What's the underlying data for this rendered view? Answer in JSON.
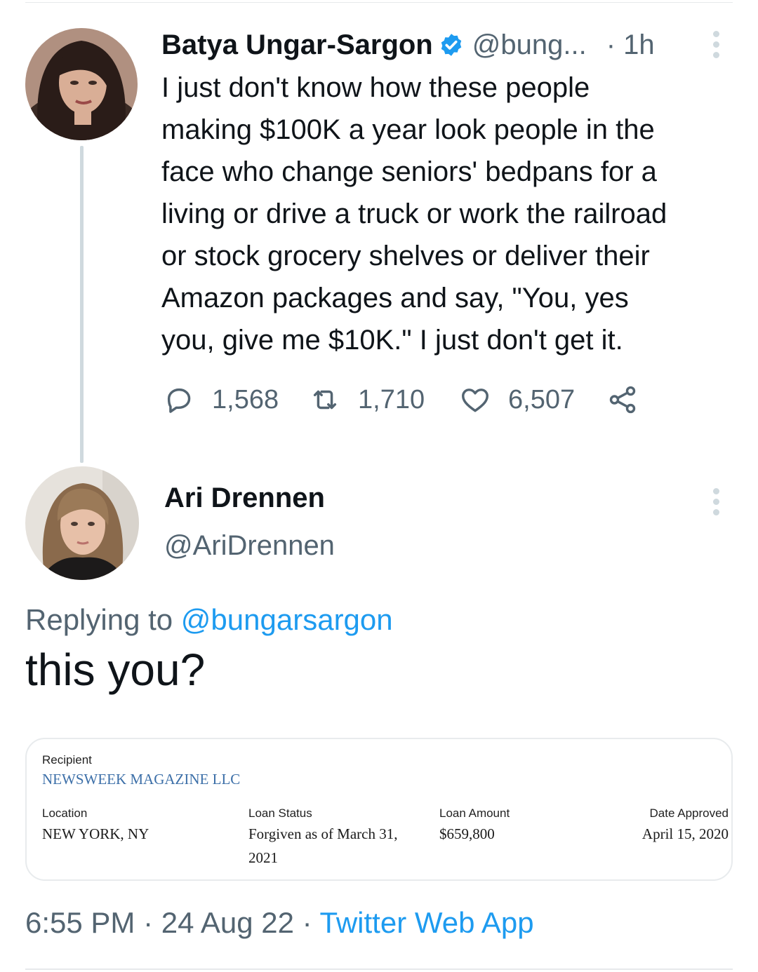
{
  "parent_tweet": {
    "author_name": "Batya Ungar-Sargon",
    "handle": "@bung...",
    "time": "· 1h",
    "text": "I just don't know how these people\nmaking $100K a year look people in the\nface who change seniors' bedpans for a\nliving or drive a truck or work the railroad\nor stock grocery shelves or deliver their\nAmazon packages and say, \"You, yes\nyou, give me $10K.\" I just don't get it.",
    "replies": "1,568",
    "retweets": "1,710",
    "likes": "6,507",
    "icons": {
      "verified": "verified-badge-icon",
      "more": "more-vertical-icon",
      "reply": "reply-bubble-icon",
      "retweet": "retweet-icon",
      "like": "heart-icon",
      "share": "share-icon"
    }
  },
  "reply_tweet": {
    "author_name": "Ari Drennen",
    "handle": "@AriDrennen",
    "replying_prefix": "Replying to ",
    "replying_to": "@bungarsargon",
    "text": "this you?"
  },
  "card": {
    "recipient_label": "Recipient",
    "recipient_value": "NEWSWEEK MAGAZINE LLC",
    "location_label": "Location",
    "location_value": "NEW YORK, NY",
    "loan_status_label": "Loan Status",
    "loan_status_line1": "Forgiven as of March 31,",
    "loan_status_line2": "2021",
    "loan_amount_label": "Loan Amount",
    "loan_amount_value": "$659,800",
    "date_approved_label": "Date Approved",
    "date_approved_value": "April 15, 2020"
  },
  "footer": {
    "time": "6:55 PM",
    "sep1": " · ",
    "date": "24 Aug 22",
    "sep2": " · ",
    "app": "Twitter Web App"
  },
  "colors": {
    "accent": "#1d9bf0",
    "muted_text": "#536471",
    "primary_text": "#0f1419",
    "border": "#e8ebed",
    "recipient_link": "#3c6fa8"
  }
}
